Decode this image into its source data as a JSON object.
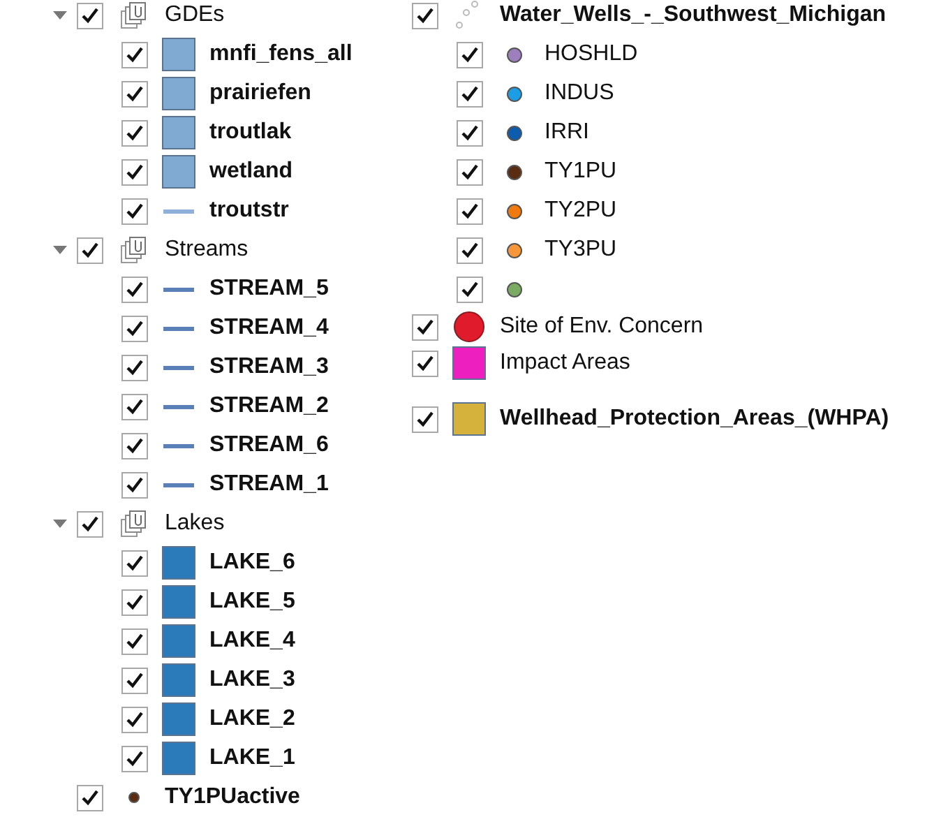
{
  "left_tree": [
    {
      "label": "GDEs",
      "kind": "group",
      "expanded": true,
      "checked": true,
      "bold": false,
      "children": [
        {
          "label": "mnfi_fens_all",
          "kind": "fill",
          "checked": true,
          "bold": true,
          "color": "#80aad2"
        },
        {
          "label": "prairiefen",
          "kind": "fill",
          "checked": true,
          "bold": true,
          "color": "#80aad2"
        },
        {
          "label": "troutlak",
          "kind": "fill",
          "checked": true,
          "bold": true,
          "color": "#80aad2"
        },
        {
          "label": "wetland",
          "kind": "fill",
          "checked": true,
          "bold": true,
          "color": "#80aad2"
        },
        {
          "label": "troutstr",
          "kind": "line",
          "checked": true,
          "bold": true,
          "color": "#8fb0d8"
        }
      ]
    },
    {
      "label": "Streams",
      "kind": "group",
      "expanded": true,
      "checked": true,
      "bold": false,
      "children": [
        {
          "label": "STREAM_5",
          "kind": "line",
          "checked": true,
          "bold": true,
          "color": "#5b80b8"
        },
        {
          "label": "STREAM_4",
          "kind": "line",
          "checked": true,
          "bold": true,
          "color": "#5b80b8"
        },
        {
          "label": "STREAM_3",
          "kind": "line",
          "checked": true,
          "bold": true,
          "color": "#5b80b8"
        },
        {
          "label": "STREAM_2",
          "kind": "line",
          "checked": true,
          "bold": true,
          "color": "#5b80b8"
        },
        {
          "label": "STREAM_6",
          "kind": "line",
          "checked": true,
          "bold": true,
          "color": "#5b80b8"
        },
        {
          "label": "STREAM_1",
          "kind": "line",
          "checked": true,
          "bold": true,
          "color": "#5b80b8"
        }
      ]
    },
    {
      "label": "Lakes",
      "kind": "group",
      "expanded": true,
      "checked": true,
      "bold": false,
      "children": [
        {
          "label": "LAKE_6",
          "kind": "fill",
          "checked": true,
          "bold": true,
          "color": "#2b7bba"
        },
        {
          "label": "LAKE_5",
          "kind": "fill",
          "checked": true,
          "bold": true,
          "color": "#2b7bba"
        },
        {
          "label": "LAKE_4",
          "kind": "fill",
          "checked": true,
          "bold": true,
          "color": "#2b7bba"
        },
        {
          "label": "LAKE_3",
          "kind": "fill",
          "checked": true,
          "bold": true,
          "color": "#2b7bba"
        },
        {
          "label": "LAKE_2",
          "kind": "fill",
          "checked": true,
          "bold": true,
          "color": "#2b7bba"
        },
        {
          "label": "LAKE_1",
          "kind": "fill",
          "checked": true,
          "bold": true,
          "color": "#2b7bba"
        }
      ]
    },
    {
      "label": "TY1PUactive",
      "kind": "marker",
      "checked": true,
      "bold": true,
      "color": "#5a2d12"
    }
  ],
  "right_tree": [
    {
      "label": "Water_Wells_-_Southwest_Michigan",
      "kind": "points",
      "checked": true,
      "bold": true,
      "children": [
        {
          "label": "HOSHLD",
          "kind": "marker",
          "checked": true,
          "bold": false,
          "color": "#9d7fbe"
        },
        {
          "label": "INDUS",
          "kind": "marker",
          "checked": true,
          "bold": false,
          "color": "#1c9ee6"
        },
        {
          "label": "IRRI",
          "kind": "marker",
          "checked": true,
          "bold": false,
          "color": "#0d5cad"
        },
        {
          "label": "TY1PU",
          "kind": "marker",
          "checked": true,
          "bold": false,
          "color": "#5a2d12"
        },
        {
          "label": "TY2PU",
          "kind": "marker",
          "checked": true,
          "bold": false,
          "color": "#f07a10"
        },
        {
          "label": "TY3PU",
          "kind": "marker",
          "checked": true,
          "bold": false,
          "color": "#f7973a"
        },
        {
          "kind": "marker",
          "checked": true,
          "color": "#79ac62"
        }
      ]
    },
    {
      "label": "Site of Env. Concern",
      "kind": "circle",
      "checked": true,
      "bold": false,
      "color": "#e01b2b"
    },
    {
      "label": "Impact Areas",
      "kind": "fill",
      "checked": true,
      "bold": false,
      "color": "#ee1fbf"
    },
    {
      "label": "Wellhead_Protection_Areas_(WHPA)",
      "kind": "fill",
      "checked": true,
      "bold": true,
      "color": "#d5b23c"
    }
  ]
}
